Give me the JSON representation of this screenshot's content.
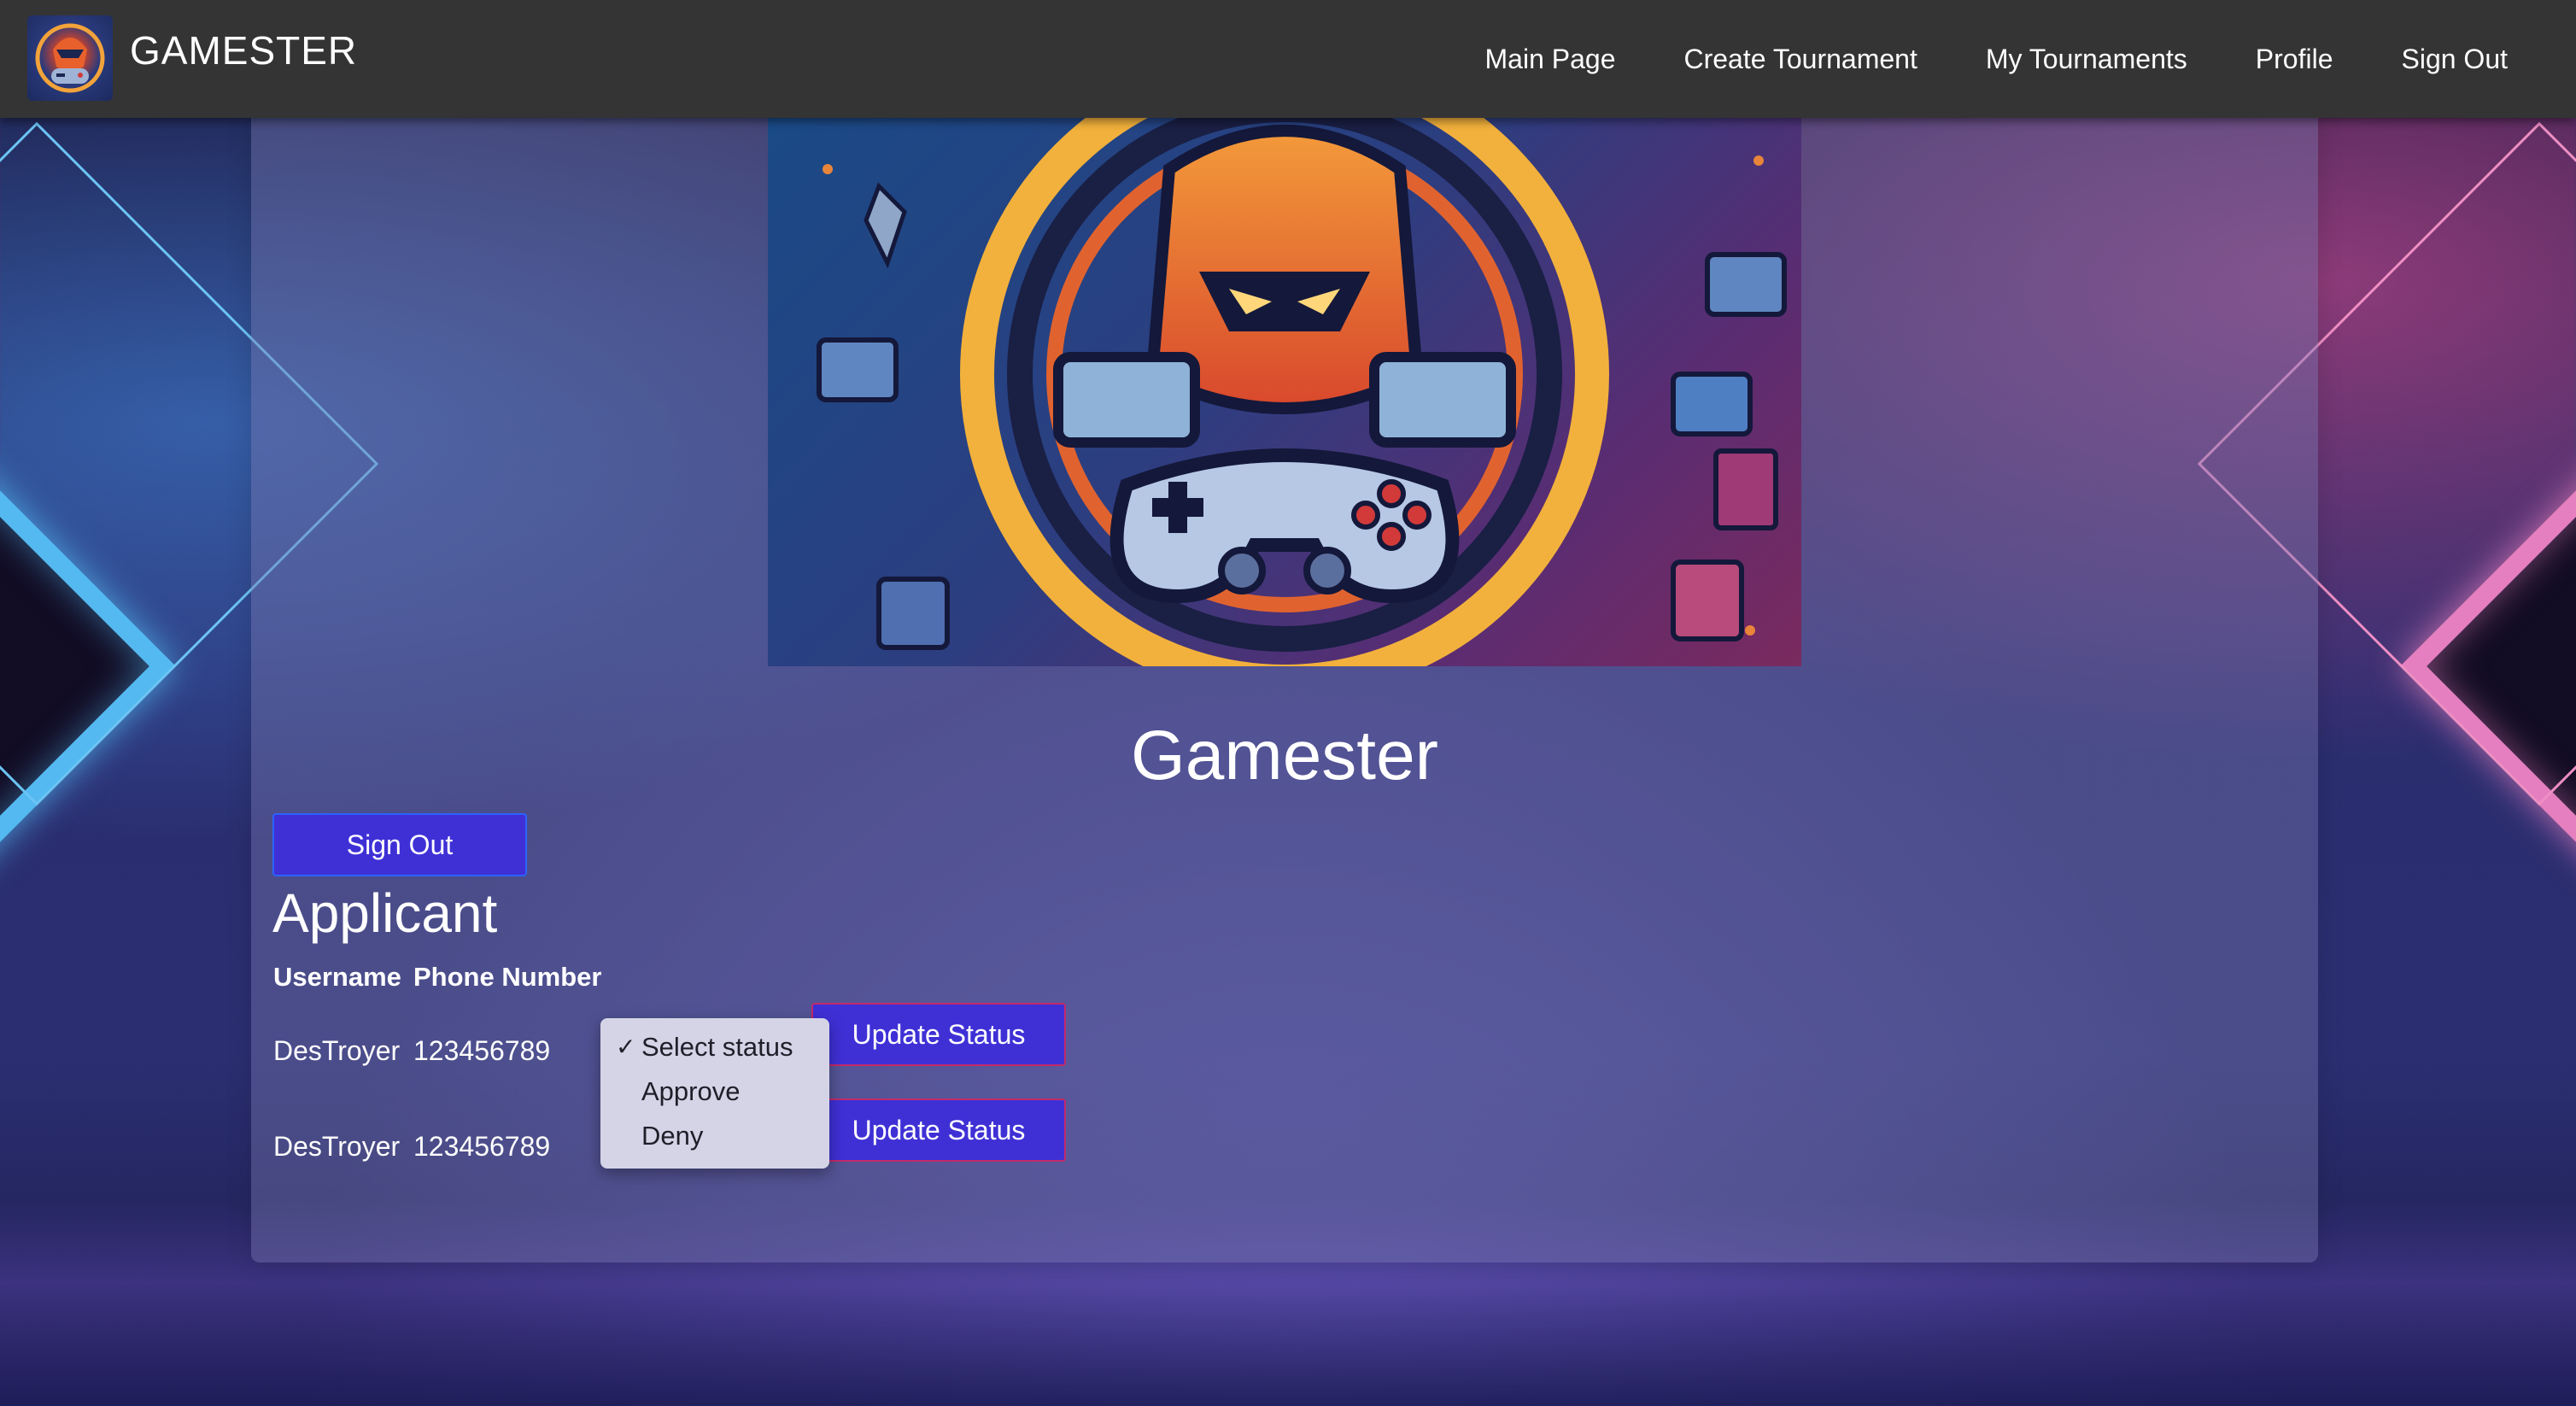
{
  "navbar": {
    "brand_name": "GAMESTER",
    "links": [
      "Main Page",
      "Create Tournament",
      "My Tournaments",
      "Profile",
      "Sign Out"
    ]
  },
  "main": {
    "title": "Gamester",
    "signout_label": "Sign Out",
    "section_heading": "Applicant",
    "table": {
      "headers": [
        "Username",
        "Phone Number"
      ],
      "rows": [
        {
          "username": "DesTroyer",
          "phone": "123456789",
          "action_label": "Update Status"
        },
        {
          "username": "DesTroyer",
          "phone": "123456789",
          "action_label": "Update Status"
        }
      ]
    },
    "status_dropdown": {
      "selected": "Select status",
      "options": [
        "Select status",
        "Approve",
        "Deny"
      ]
    }
  },
  "icons": {
    "brand_logo": "gamer-robot-logo-icon",
    "check": "checkmark-icon"
  },
  "colors": {
    "navbar_bg": "#343434",
    "button_bg": "#3f30d6",
    "update_button_border": "#c22a6a",
    "neon_blue": "#54b9f1",
    "neon_pink": "#e57fbf"
  }
}
